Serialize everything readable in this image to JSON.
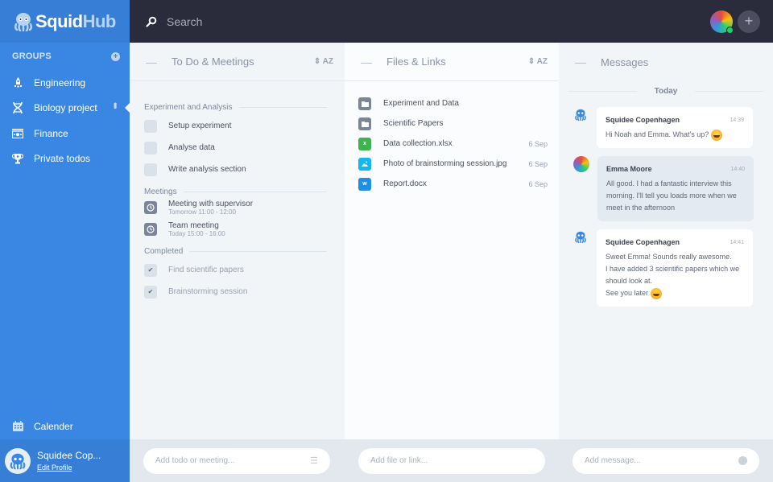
{
  "app": {
    "logo_main": "Squid",
    "logo_accent": "Hub",
    "brand_color": "#3a87e3"
  },
  "sidebar": {
    "groups_title": "GROUPS",
    "items": [
      {
        "label": "Engineering",
        "icon": "rocket-icon"
      },
      {
        "label": "Biology project",
        "icon": "dna-icon",
        "active": true
      },
      {
        "label": "Finance",
        "icon": "money-icon"
      },
      {
        "label": "Private todos",
        "icon": "trophy-icon"
      }
    ],
    "calendar_label": "Calender",
    "profile": {
      "name": "Squidee Cop...",
      "edit_label": "Edit Profile"
    }
  },
  "topbar": {
    "search_placeholder": "Search",
    "add_label": "+"
  },
  "todo": {
    "title": "To Do & Meetings",
    "sort_label": "AZ",
    "sections": {
      "experiment": "Experiment and Analysis",
      "meetings": "Meetings",
      "completed": "Completed"
    },
    "tasks": [
      {
        "label": "Setup experiment"
      },
      {
        "label": "Analyse data"
      },
      {
        "label": "Write analysis section"
      }
    ],
    "meetings": [
      {
        "title": "Meeting with supervisor",
        "time": "Tomorrow 11:00 - 12:00"
      },
      {
        "title": "Team meeting",
        "time": "Today 15:00 - 16:00"
      }
    ],
    "completed": [
      {
        "label": "Find scientific papers"
      },
      {
        "label": "Brainstorming session"
      }
    ],
    "input_placeholder": "Add todo or meeting..."
  },
  "files": {
    "title": "Files & Links",
    "sort_label": "AZ",
    "items": [
      {
        "name": "Experiment and Data",
        "type": "folder",
        "date": ""
      },
      {
        "name": "Scientific Papers",
        "type": "folder",
        "date": ""
      },
      {
        "name": "Data collection.xlsx",
        "type": "excel",
        "badge": "x",
        "date": "6 Sep"
      },
      {
        "name": "Photo of brainstorming session.jpg",
        "type": "image",
        "date": "6 Sep"
      },
      {
        "name": "Report.docx",
        "type": "word",
        "badge": "w",
        "date": "6 Sep"
      }
    ],
    "input_placeholder": "Add file or link..."
  },
  "messages": {
    "title": "Messages",
    "day_label": "Today",
    "items": [
      {
        "author": "Squidee Copenhagen",
        "time": "14:39",
        "text": "Hi Noah and Emma. What's up?",
        "emoji": true
      },
      {
        "author": "Emma Moore",
        "time": "14:40",
        "text": "All good. I had a fantastic interview this morning. I'll tell you loads more when we meet in the afternoon",
        "emoji": false
      },
      {
        "author": "Squidee Copenhagen",
        "time": "14:41",
        "text": "Sweet Emma! Sounds really awesome.\nI have added 3 scientific papers which we should look at.\nSee you later",
        "emoji": true
      }
    ],
    "input_placeholder": "Add message..."
  }
}
